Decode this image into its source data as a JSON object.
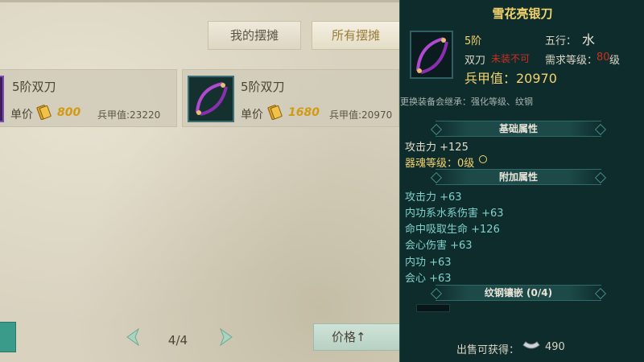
{
  "tabs": {
    "my_stall": "我的摆摊",
    "all_stalls": "所有摆摊"
  },
  "listings": [
    {
      "name": "5阶双刀",
      "price_label": "单价",
      "price": "800",
      "stat": "兵甲值:23220"
    },
    {
      "name": "5阶双刀",
      "price_label": "单价",
      "price": "1680",
      "stat": "兵甲值:20970"
    }
  ],
  "pagination": {
    "text": "4/4"
  },
  "sort": {
    "label": "价格↑"
  },
  "tooltip": {
    "title": "雪花亮银刀",
    "tier": "5阶",
    "weapon_type": "双刀",
    "bind_status": "未装不可",
    "element_label": "五行：",
    "element_glyph": "水",
    "req_label": "需求等级：",
    "req_level": "80",
    "req_unit": "级",
    "power": "兵甲值：20970",
    "inherit_note": "更换装备会继承：强化等级、纹钢",
    "sections": {
      "basic": "基础属性",
      "extra": "附加属性",
      "socket": "纹钢镶嵌 (0/4)"
    },
    "basic_attrs": [
      "攻击力  +125",
      "器魂等级：0级"
    ],
    "extra_attrs": [
      "攻击力  +63",
      "内功系水系伤害  +63",
      "命中吸取生命  +126",
      "会心伤害  +63",
      "内功  +63",
      "会心  +63"
    ],
    "sell_label": "出售可获得：",
    "sell_value": "490"
  },
  "colors": {
    "gold": "#f3d36b",
    "teal_text": "#7fd1ca",
    "red_text": "#c9301f",
    "panel_bg": "#0f2c2d",
    "price_gold": "#d19a12"
  },
  "icons": {
    "weapon": "dual-blade-icon",
    "currency": "gold-ingot-icon",
    "silver": "silver-ingot-icon",
    "prev": "left-arrow-icon",
    "next": "right-arrow-icon"
  }
}
